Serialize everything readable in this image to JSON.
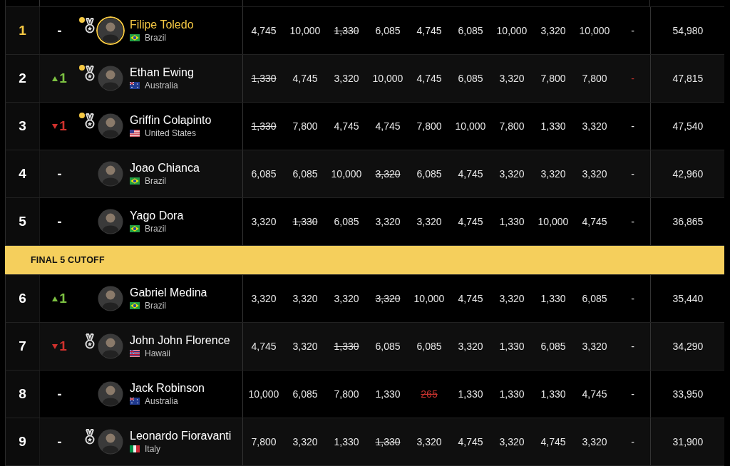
{
  "rows": [
    {
      "rank": "1",
      "leader": true,
      "change": {
        "kind": "none",
        "text": "-"
      },
      "dot": true,
      "medal": true,
      "name": "Filipe Toledo",
      "country": {
        "kind": "br",
        "name": "Brazil"
      },
      "scores": [
        {
          "text": "4,745",
          "dropped": false,
          "flagged": false
        },
        {
          "text": "10,000",
          "dropped": false,
          "flagged": false
        },
        {
          "text": "1,330",
          "dropped": true,
          "flagged": false
        },
        {
          "text": "6,085",
          "dropped": false,
          "flagged": false
        },
        {
          "text": "4,745",
          "dropped": false,
          "flagged": false
        },
        {
          "text": "6,085",
          "dropped": false,
          "flagged": false
        },
        {
          "text": "10,000",
          "dropped": false,
          "flagged": false
        },
        {
          "text": "3,320",
          "dropped": false,
          "flagged": false
        },
        {
          "text": "10,000",
          "dropped": false,
          "flagged": false
        },
        {
          "text": "-",
          "flagged": false
        }
      ],
      "points": "54,980"
    },
    {
      "rank": "2",
      "leader": false,
      "change": {
        "kind": "up",
        "text": "1"
      },
      "dot": true,
      "medal": true,
      "name": "Ethan Ewing",
      "country": {
        "kind": "au",
        "name": "Australia"
      },
      "scores": [
        {
          "text": "1,330",
          "dropped": true,
          "flagged": false
        },
        {
          "text": "4,745",
          "dropped": false,
          "flagged": false
        },
        {
          "text": "3,320",
          "dropped": false,
          "flagged": false
        },
        {
          "text": "10,000",
          "dropped": false,
          "flagged": false
        },
        {
          "text": "4,745",
          "dropped": false,
          "flagged": false
        },
        {
          "text": "6,085",
          "dropped": false,
          "flagged": false
        },
        {
          "text": "3,320",
          "dropped": false,
          "flagged": false
        },
        {
          "text": "7,800",
          "dropped": false,
          "flagged": false
        },
        {
          "text": "7,800",
          "dropped": false,
          "flagged": false
        },
        {
          "text": "-",
          "flagged": true
        }
      ],
      "points": "47,815"
    },
    {
      "rank": "3",
      "leader": false,
      "change": {
        "kind": "down",
        "text": "1"
      },
      "dot": true,
      "medal": true,
      "name": "Griffin Colapinto",
      "country": {
        "kind": "us",
        "name": "United States"
      },
      "scores": [
        {
          "text": "1,330",
          "dropped": true,
          "flagged": false
        },
        {
          "text": "7,800",
          "dropped": false,
          "flagged": false
        },
        {
          "text": "4,745",
          "dropped": false,
          "flagged": false
        },
        {
          "text": "4,745",
          "dropped": false,
          "flagged": false
        },
        {
          "text": "7,800",
          "dropped": false,
          "flagged": false
        },
        {
          "text": "10,000",
          "dropped": false,
          "flagged": false
        },
        {
          "text": "7,800",
          "dropped": false,
          "flagged": false
        },
        {
          "text": "1,330",
          "dropped": false,
          "flagged": false
        },
        {
          "text": "3,320",
          "dropped": false,
          "flagged": false
        },
        {
          "text": "-",
          "flagged": false
        }
      ],
      "points": "47,540"
    },
    {
      "rank": "4",
      "leader": false,
      "change": {
        "kind": "none",
        "text": "-"
      },
      "dot": false,
      "medal": false,
      "name": "Joao Chianca",
      "country": {
        "kind": "br",
        "name": "Brazil"
      },
      "scores": [
        {
          "text": "6,085",
          "dropped": false,
          "flagged": false
        },
        {
          "text": "6,085",
          "dropped": false,
          "flagged": false
        },
        {
          "text": "10,000",
          "dropped": false,
          "flagged": false
        },
        {
          "text": "3,320",
          "dropped": true,
          "flagged": false
        },
        {
          "text": "6,085",
          "dropped": false,
          "flagged": false
        },
        {
          "text": "4,745",
          "dropped": false,
          "flagged": false
        },
        {
          "text": "3,320",
          "dropped": false,
          "flagged": false
        },
        {
          "text": "3,320",
          "dropped": false,
          "flagged": false
        },
        {
          "text": "3,320",
          "dropped": false,
          "flagged": false
        },
        {
          "text": "-",
          "flagged": false
        }
      ],
      "points": "42,960"
    },
    {
      "rank": "5",
      "leader": false,
      "change": {
        "kind": "none",
        "text": "-"
      },
      "dot": false,
      "medal": false,
      "name": "Yago Dora",
      "country": {
        "kind": "br",
        "name": "Brazil"
      },
      "scores": [
        {
          "text": "3,320",
          "dropped": false,
          "flagged": false
        },
        {
          "text": "1,330",
          "dropped": true,
          "flagged": false
        },
        {
          "text": "6,085",
          "dropped": false,
          "flagged": false
        },
        {
          "text": "3,320",
          "dropped": false,
          "flagged": false
        },
        {
          "text": "3,320",
          "dropped": false,
          "flagged": false
        },
        {
          "text": "4,745",
          "dropped": false,
          "flagged": false
        },
        {
          "text": "1,330",
          "dropped": false,
          "flagged": false
        },
        {
          "text": "10,000",
          "dropped": false,
          "flagged": false
        },
        {
          "text": "4,745",
          "dropped": false,
          "flagged": false
        },
        {
          "text": "-",
          "flagged": false
        }
      ],
      "points": "36,865"
    },
    {
      "kind": "cutoff",
      "label": "FINAL 5 CUTOFF"
    },
    {
      "rank": "6",
      "leader": false,
      "change": {
        "kind": "up",
        "text": "1"
      },
      "dot": false,
      "medal": false,
      "name": "Gabriel Medina",
      "country": {
        "kind": "br",
        "name": "Brazil"
      },
      "scores": [
        {
          "text": "3,320",
          "dropped": false,
          "flagged": false
        },
        {
          "text": "3,320",
          "dropped": false,
          "flagged": false
        },
        {
          "text": "3,320",
          "dropped": false,
          "flagged": false
        },
        {
          "text": "3,320",
          "dropped": true,
          "flagged": false
        },
        {
          "text": "10,000",
          "dropped": false,
          "flagged": false
        },
        {
          "text": "4,745",
          "dropped": false,
          "flagged": false
        },
        {
          "text": "3,320",
          "dropped": false,
          "flagged": false
        },
        {
          "text": "1,330",
          "dropped": false,
          "flagged": false
        },
        {
          "text": "6,085",
          "dropped": false,
          "flagged": false
        },
        {
          "text": "-",
          "flagged": false
        }
      ],
      "points": "35,440"
    },
    {
      "rank": "7",
      "leader": false,
      "change": {
        "kind": "down",
        "text": "1"
      },
      "dot": false,
      "medal": true,
      "name": "John John Florence",
      "country": {
        "kind": "hi",
        "name": "Hawaii"
      },
      "scores": [
        {
          "text": "4,745",
          "dropped": false,
          "flagged": false
        },
        {
          "text": "3,320",
          "dropped": false,
          "flagged": false
        },
        {
          "text": "1,330",
          "dropped": true,
          "flagged": false
        },
        {
          "text": "6,085",
          "dropped": false,
          "flagged": false
        },
        {
          "text": "6,085",
          "dropped": false,
          "flagged": false
        },
        {
          "text": "3,320",
          "dropped": false,
          "flagged": false
        },
        {
          "text": "1,330",
          "dropped": false,
          "flagged": false
        },
        {
          "text": "6,085",
          "dropped": false,
          "flagged": false
        },
        {
          "text": "3,320",
          "dropped": false,
          "flagged": false
        },
        {
          "text": "-",
          "flagged": false
        }
      ],
      "points": "34,290"
    },
    {
      "rank": "8",
      "leader": false,
      "change": {
        "kind": "none",
        "text": "-"
      },
      "dot": false,
      "medal": false,
      "name": "Jack Robinson",
      "country": {
        "kind": "au",
        "name": "Australia"
      },
      "scores": [
        {
          "text": "10,000",
          "dropped": false,
          "flagged": false
        },
        {
          "text": "6,085",
          "dropped": false,
          "flagged": false
        },
        {
          "text": "7,800",
          "dropped": false,
          "flagged": false
        },
        {
          "text": "1,330",
          "dropped": false,
          "flagged": false
        },
        {
          "text": "265",
          "dropped": true,
          "flagged": true
        },
        {
          "text": "1,330",
          "dropped": false,
          "flagged": false
        },
        {
          "text": "1,330",
          "dropped": false,
          "flagged": false
        },
        {
          "text": "1,330",
          "dropped": false,
          "flagged": false
        },
        {
          "text": "4,745",
          "dropped": false,
          "flagged": false
        },
        {
          "text": "-",
          "flagged": false
        }
      ],
      "points": "33,950"
    },
    {
      "rank": "9",
      "leader": false,
      "change": {
        "kind": "none",
        "text": "-"
      },
      "dot": false,
      "medal": true,
      "name": "Leonardo Fioravanti",
      "country": {
        "kind": "it",
        "name": "Italy"
      },
      "scores": [
        {
          "text": "7,800",
          "dropped": false,
          "flagged": false
        },
        {
          "text": "3,320",
          "dropped": false,
          "flagged": false
        },
        {
          "text": "1,330",
          "dropped": false,
          "flagged": false
        },
        {
          "text": "1,330",
          "dropped": true,
          "flagged": false
        },
        {
          "text": "3,320",
          "dropped": false,
          "flagged": false
        },
        {
          "text": "4,745",
          "dropped": false,
          "flagged": false
        },
        {
          "text": "3,320",
          "dropped": false,
          "flagged": false
        },
        {
          "text": "4,745",
          "dropped": false,
          "flagged": false
        },
        {
          "text": "3,320",
          "dropped": false,
          "flagged": false
        },
        {
          "text": "-",
          "flagged": false
        }
      ],
      "points": "31,900"
    }
  ]
}
